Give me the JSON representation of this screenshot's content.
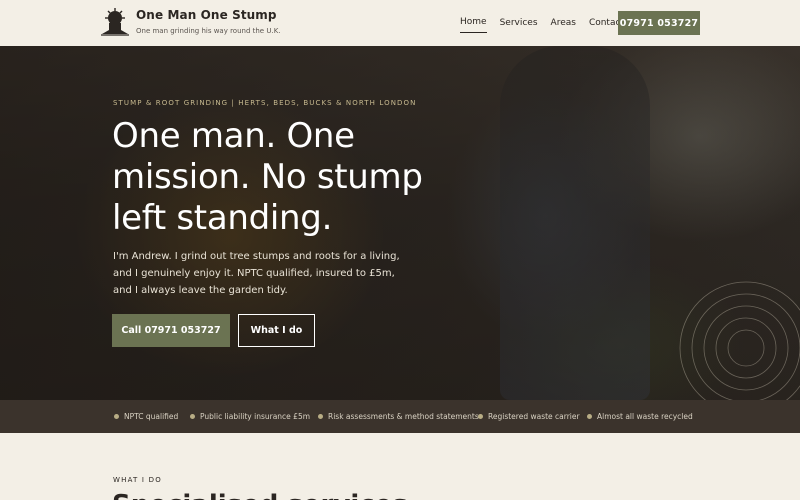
{
  "header": {
    "brand_name": "One Man One Stump",
    "tagline": "One man grinding his way round the U.K.",
    "logo_icon": "stump-grinder-logo-icon",
    "nav": [
      {
        "label": "Home",
        "active": true
      },
      {
        "label": "Services",
        "active": false
      },
      {
        "label": "Areas",
        "active": false
      },
      {
        "label": "Contact",
        "active": false
      }
    ],
    "cta_label": "07971 053727"
  },
  "hero": {
    "eyebrow": "STUMP & ROOT GRINDING | HERTS, BEDS, BUCKS & NORTH LONDON",
    "title": "One man. One mission. No stump left standing.",
    "body": "I'm Andrew. I grind out tree stumps and roots for a living, and I genuinely enjoy it. NPTC qualified, insured to £5m, and I always leave the garden tidy.",
    "primary_button": "Call 07971 053727",
    "secondary_button": "What I do"
  },
  "trust_bar": {
    "items": [
      "NPTC qualified",
      "Public liability insurance £5m",
      "Risk assessments & method statements",
      "Registered waste carrier",
      "Almost all waste recycled"
    ]
  },
  "section": {
    "eyebrow": "WHAT I DO",
    "title": "Specialised services"
  },
  "colors": {
    "accent": "#6b7352",
    "cream": "#f3efe6",
    "dark_band": "#3b332c",
    "eyebrow_gold": "#c7b98f"
  }
}
